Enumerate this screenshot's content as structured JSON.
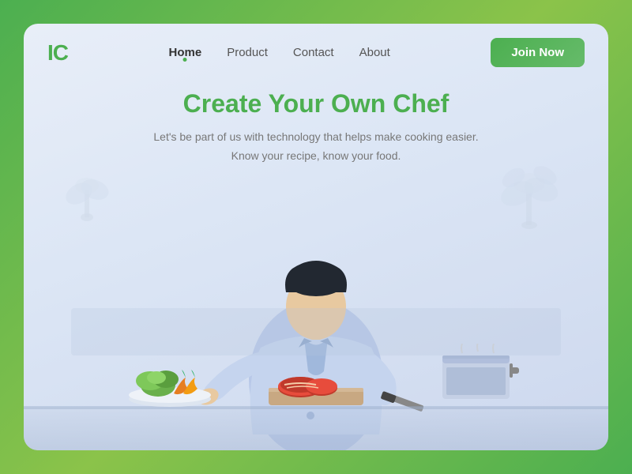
{
  "logo": {
    "text": "IC",
    "color": "#4CAF50"
  },
  "navbar": {
    "links": [
      {
        "label": "Home",
        "active": true
      },
      {
        "label": "Product",
        "active": false
      },
      {
        "label": "Contact",
        "active": false
      },
      {
        "label": "About",
        "active": false
      }
    ],
    "cta_label": "Join Now"
  },
  "hero": {
    "title": "Create Your Own Chef",
    "subtitle_line1": "Let's be part of us with technology that helps make cooking easier.",
    "subtitle_line2": "Know your recipe, know your food."
  },
  "illustration": {
    "chef_alt": "Chef illustration"
  }
}
